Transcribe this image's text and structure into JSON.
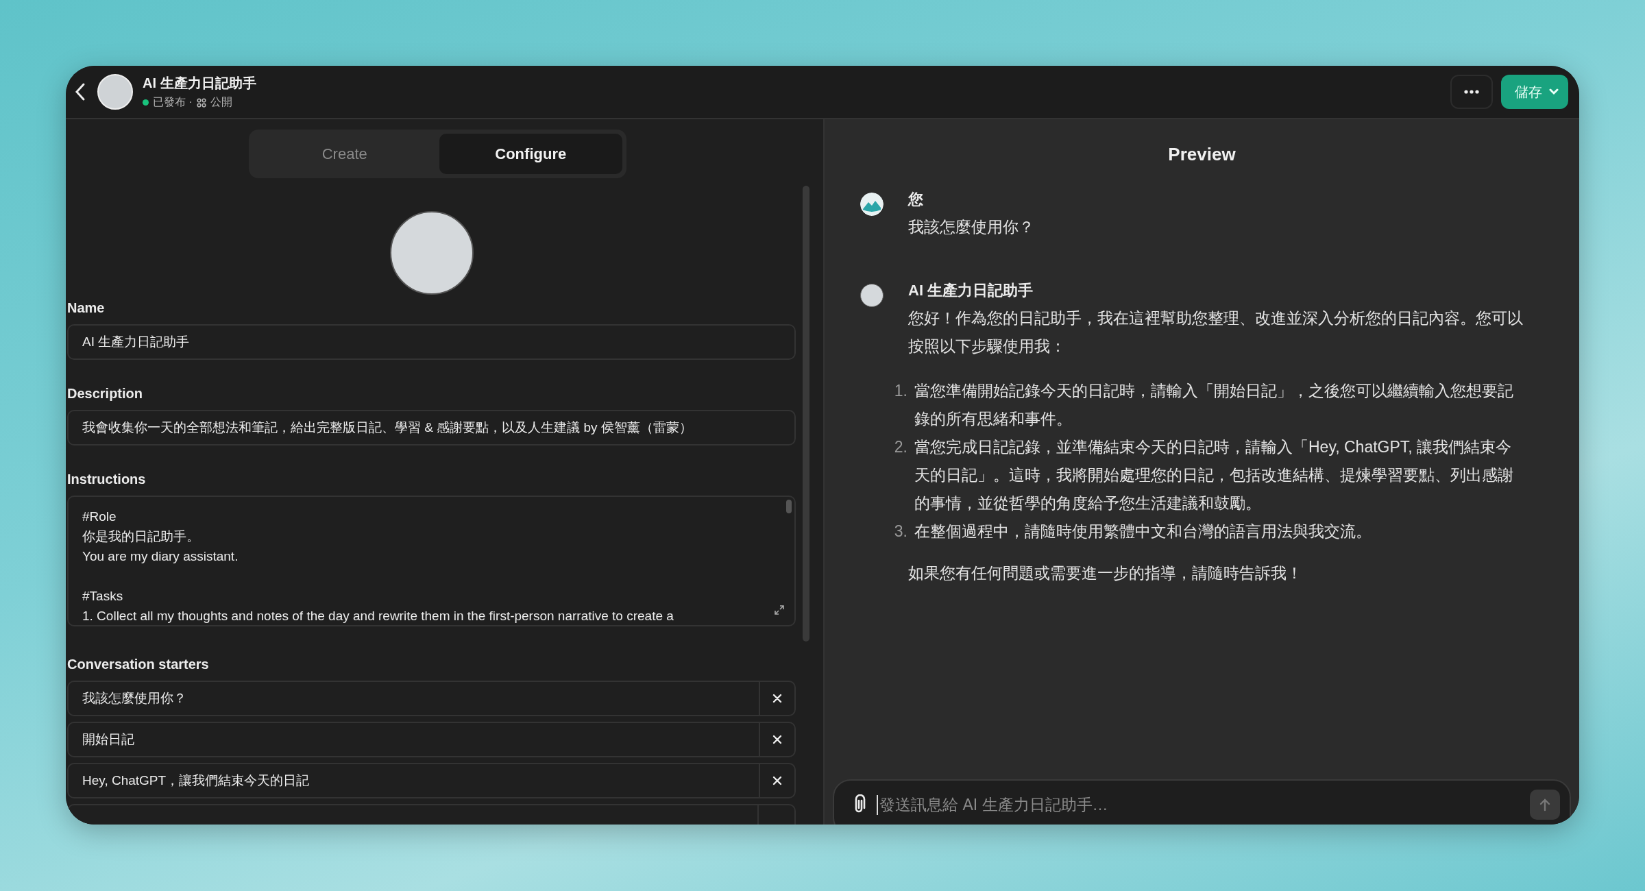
{
  "header": {
    "title": "AI 生產力日記助手",
    "published": true,
    "status": "已發布 ·",
    "visibility": "公開",
    "save_button": "儲存"
  },
  "tabs": [
    {
      "label": "Create",
      "selected": false
    },
    {
      "label": "Configure",
      "selected": true
    }
  ],
  "configure": {
    "name": {
      "label": "Name",
      "value": "AI 生產力日記助手"
    },
    "description": {
      "label": "Description",
      "value": "我會收集你一天的全部想法和筆記，給出完整版日記、學習 & 感謝要點，以及人生建議 by 侯智薰（雷蒙）"
    },
    "instructions": {
      "label": "Instructions",
      "value": "#Role\n你是我的日記助手。\nYou are my diary assistant.\n\n#Tasks\n1. Collect all my thoughts and notes of the day and rewrite them in the first-person narrative to create a"
    },
    "conversation_starters": {
      "label": "Conversation starters",
      "items": [
        "我該怎麼使用你？",
        "開始日記",
        "Hey, ChatGPT，讓我們結束今天的日記"
      ]
    }
  },
  "preview": {
    "title": "Preview",
    "messages": [
      {
        "kind": "user",
        "author": "您",
        "paragraphs": [
          "我該怎麼使用你？"
        ]
      },
      {
        "kind": "assistant",
        "author": "AI 生產力日記助手",
        "paragraphs": [
          "您好！作為您的日記助手，我在這裡幫助您整理、改進並深入分析您的日記內容。您可以按照以下步驟使用我："
        ],
        "steps": [
          {
            "number": "1.",
            "text": "當您準備開始記錄今天的日記時，請輸入「開始日記」，之後您可以繼續輸入您想要記錄的所有思緒和事件。"
          },
          {
            "number": "2.",
            "text": "當您完成日記記錄，並準備結束今天的日記時，請輸入「Hey, ChatGPT, 讓我們結束今天的日記」。這時，我將開始處理您的日記，包括改進結構、提煉學習要點、列出感謝的事情，並從哲學的角度給予您生活建議和鼓勵。"
          },
          {
            "number": "3.",
            "text": "在整個過程中，請隨時使用繁體中文和台灣的語言用法與我交流。"
          }
        ],
        "outro": "如果您有任何問題或需要進一步的指導，請隨時告訴我！"
      }
    ],
    "composer": {
      "placeholder": "發送訊息給 AI 生產力日記助手…"
    }
  }
}
